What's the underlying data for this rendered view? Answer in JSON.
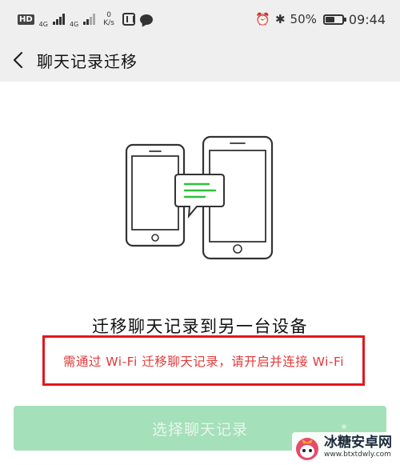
{
  "status_bar": {
    "hd": "HD",
    "sim1": "4G",
    "sim2": "4G",
    "speed_value": "0",
    "speed_unit": "K/s",
    "battery": "50%",
    "battery_level": 0.5,
    "time": "09:44",
    "icons": [
      "signal-icon",
      "nfc-icon",
      "chat-bubble-icon",
      "alarm-icon",
      "bluetooth-icon",
      "battery-icon"
    ]
  },
  "header": {
    "back_icon": "chevron-left-icon",
    "title": "聊天记录迁移"
  },
  "main": {
    "title": "迁移聊天记录到另一台设备",
    "notice": "需通过 Wi-Fi 迁移聊天记录，请开启并连接 Wi-Fi",
    "select_button": "选择聊天记录",
    "select_button_extra": "*"
  },
  "watermark": {
    "name": "冰糖安卓网",
    "url": "www.btxtdwly.com"
  },
  "colors": {
    "status_bar_bg": "#efefef",
    "header_bg": "#efefef",
    "notice_border": "#e5161b",
    "notice_text": "#e23a3a",
    "button_bg": "#a4e0ba",
    "chat_lines": "#2fbf3a"
  }
}
